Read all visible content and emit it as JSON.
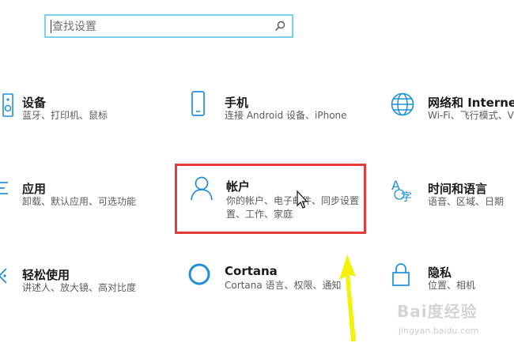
{
  "search": {
    "placeholder": "查找设置",
    "icon": "search-icon"
  },
  "tiles": [
    {
      "title": "设备",
      "desc": [
        "蓝牙、打印机、鼠标"
      ],
      "icon": "keyboard-speaker-icon"
    },
    {
      "title": "手机",
      "desc": [
        "连接 Android 设备、iPhone"
      ],
      "icon": "phone-icon"
    },
    {
      "title": "网络和 Internet",
      "desc": [
        "Wi-Fi、飞行模式、VPN"
      ],
      "icon": "globe-icon"
    },
    {
      "title": "应用",
      "desc": [
        "卸载、默认应用、可选功能"
      ],
      "icon": "app-list-icon"
    },
    {
      "title": "帐户",
      "desc": [
        "你的帐户、电子邮件、同步设置",
        "置、工作、家庭"
      ],
      "icon": "person-icon"
    },
    {
      "title": "时间和语言",
      "desc": [
        "语音、区域、日期"
      ],
      "icon": "time-language-icon"
    },
    {
      "title": "轻松使用",
      "desc": [
        "讲述人、放大镜、高对比度"
      ],
      "icon": "ease-of-access-icon"
    },
    {
      "title": "Cortana",
      "desc": [
        "Cortana 语言、权限、通知"
      ],
      "icon": "cortana-circle-icon"
    },
    {
      "title": "隐私",
      "desc": [
        "位置、相机"
      ],
      "icon": "lock-icon"
    }
  ],
  "annotations": {
    "highlight_color": "#e43b3b",
    "arrow_color": "#f2f20a",
    "accent_color": "#1e8fd8"
  },
  "watermark": {
    "brand": "Bai度经验",
    "url": "jingyan.baidu.com"
  }
}
